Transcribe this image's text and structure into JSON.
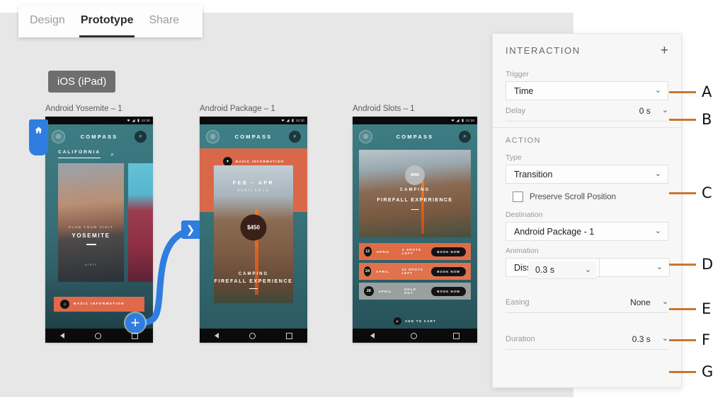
{
  "tabs": [
    {
      "label": "Design",
      "active": false
    },
    {
      "label": "Prototype",
      "active": true
    },
    {
      "label": "Share",
      "active": false
    }
  ],
  "device_badge": "iOS (iPad)",
  "artboards": [
    {
      "label": "Android Yosemite – 1",
      "status_time": "12:30",
      "brand": "COMPASS",
      "tab_label": "CALIFORNIA",
      "card_kicker": "PLAN YOUR VISIT",
      "card_title": "YOSEMITE",
      "card_visit": "VISIT",
      "cta_label": "BASIC INFORMATION"
    },
    {
      "label": "Android Package – 1",
      "status_time": "12:30",
      "brand": "COMPASS",
      "band_label": "BASIC INFORMATION",
      "card_dates": "FEB  –  APR",
      "card_available": "AVAILABLE",
      "price": "$450",
      "card_kicker": "CAMPING",
      "card_title": "FIREFALL EXPERIENCE"
    },
    {
      "label": "Android Slots – 1",
      "status_time": "12:30",
      "brand": "COMPASS",
      "price": "$450",
      "hero_kicker": "CAMPING",
      "hero_title": "FIREFALL EXPERIENCE",
      "slots": [
        {
          "day": "12",
          "month": "APRIL",
          "status": "4 SPOTS LEFT",
          "button": "BOOK NOW",
          "sold_out": false
        },
        {
          "day": "24",
          "month": "APRIL",
          "status": "22 SPOTS LEFT",
          "button": "BOOK NOW",
          "sold_out": false
        },
        {
          "day": "28",
          "month": "APRIL",
          "status": "SOLD OUT",
          "button": "BOOK NOW",
          "sold_out": true
        }
      ],
      "cart_label": "ADD TO CART"
    }
  ],
  "panel": {
    "title": "INTERACTION",
    "add_label": "+",
    "trigger_label": "Trigger",
    "trigger_value": "Time",
    "delay_label": "Delay",
    "delay_value": "0 s",
    "action_title": "ACTION",
    "type_label": "Type",
    "type_value": "Transition",
    "preserve_label": "Preserve Scroll Position",
    "destination_label": "Destination",
    "destination_value": "Android Package - 1",
    "animation_label": "Animation",
    "animation_value": "Dissolve",
    "animation_overlay_value": "0.3 s",
    "animation_right_value": "",
    "easing_label": "Easing",
    "easing_value": "None",
    "duration_label": "Duration",
    "duration_value": "0.3 s"
  },
  "callouts": [
    {
      "letter": "A"
    },
    {
      "letter": "B"
    },
    {
      "letter": "C"
    },
    {
      "letter": "D"
    },
    {
      "letter": "E"
    },
    {
      "letter": "F"
    },
    {
      "letter": "G"
    }
  ],
  "colors": {
    "accent_blue": "#2f7de1",
    "callout_orange": "#c8772e",
    "canvas": "#e7e7e7",
    "panel_bg": "#f7f7f7",
    "orange_cta": "#e0694a"
  }
}
